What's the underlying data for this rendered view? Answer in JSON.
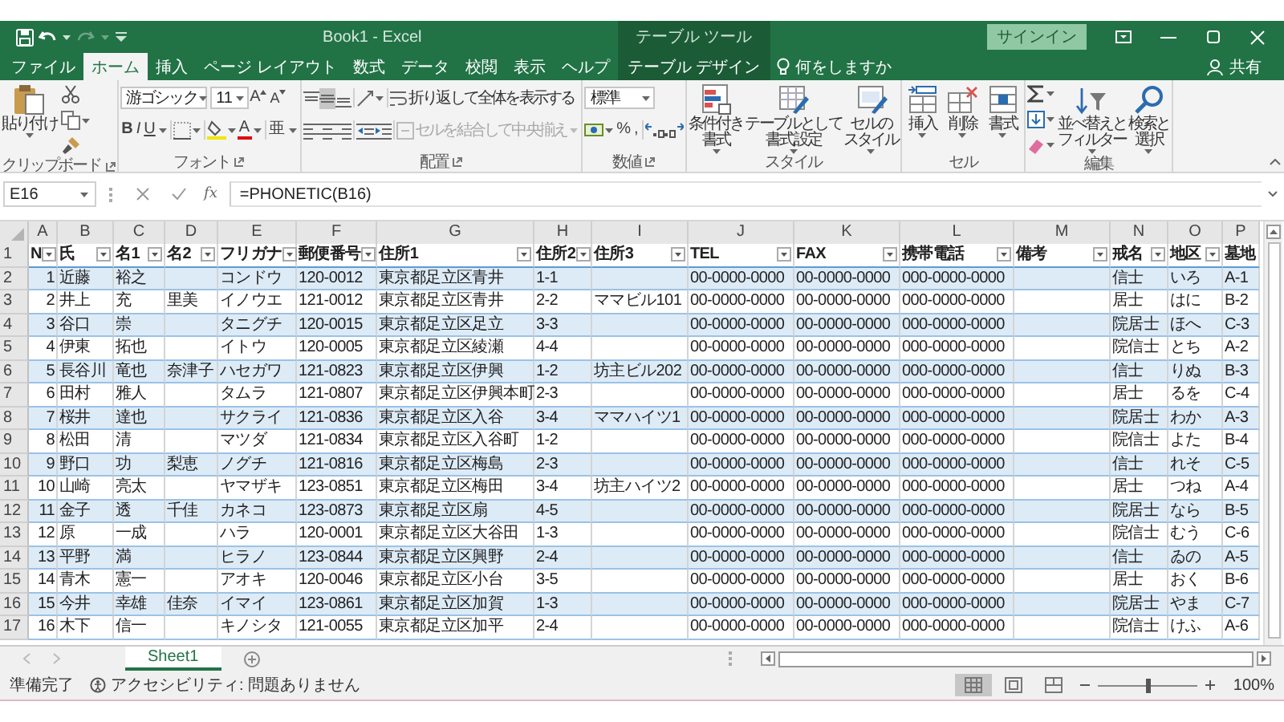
{
  "title_bar": {
    "title": "Book1 - Excel",
    "context_group": "テーブル ツール",
    "sign_in": "サインイン"
  },
  "ribbon_tabs": [
    {
      "label": "ファイル",
      "selected": false,
      "kind": "standard"
    },
    {
      "label": "ホーム",
      "selected": true,
      "kind": "standard"
    },
    {
      "label": "挿入",
      "selected": false,
      "kind": "standard"
    },
    {
      "label": "ページ レイアウト",
      "selected": false,
      "kind": "standard"
    },
    {
      "label": "数式",
      "selected": false,
      "kind": "standard"
    },
    {
      "label": "データ",
      "selected": false,
      "kind": "standard"
    },
    {
      "label": "校閲",
      "selected": false,
      "kind": "standard"
    },
    {
      "label": "表示",
      "selected": false,
      "kind": "standard"
    },
    {
      "label": "ヘルプ",
      "selected": false,
      "kind": "standard"
    },
    {
      "label": "テーブル デザイン",
      "selected": false,
      "kind": "contextual"
    }
  ],
  "tell_me": "何をしますか",
  "share": "共有",
  "ribbon": {
    "clipboard": {
      "paste": "貼り付け",
      "label": "クリップボード"
    },
    "font": {
      "font_name": "游ゴシック",
      "font_size": "11",
      "grow": "A",
      "shrink": "A",
      "bold": "B",
      "italic": "I",
      "underline": "U",
      "font_color": "A",
      "phonetic": "亜",
      "label": "フォント"
    },
    "alignment": {
      "vertical": [
        {
          "selected": false
        },
        {
          "selected": true
        },
        {
          "selected": false
        }
      ],
      "horizontal": [
        {
          "selected": false
        },
        {
          "selected": false
        },
        {
          "selected": false
        }
      ],
      "wrap_text": "折り返して全体を表示する",
      "merge": {
        "label": "セルを結合して中央揃え",
        "disabled": true
      },
      "label": "配置"
    },
    "number": {
      "format": "標準",
      "percent": "%",
      "comma": ",",
      "label": "数値"
    },
    "styles": {
      "buttons": [
        [
          "条件付き",
          "書式"
        ],
        [
          "テーブルとして",
          "書式設定"
        ],
        [
          "セルの",
          "スタイル"
        ]
      ],
      "label": "スタイル"
    },
    "cells": {
      "buttons": [
        "挿入",
        "削除",
        "書式"
      ],
      "label": "セル"
    },
    "editing": {
      "buttons": [
        [
          "並べ替えと",
          "フィルター"
        ],
        [
          "検索と",
          "選択"
        ]
      ],
      "label": "編集"
    }
  },
  "formula_bar": {
    "name_box": "E16",
    "fx": "fx",
    "formula": "=PHONETIC(B16)"
  },
  "sheet": {
    "columns": [
      "A",
      "B",
      "C",
      "D",
      "E",
      "F",
      "G",
      "H",
      "I",
      "J",
      "K",
      "L",
      "M",
      "N",
      "O",
      "P"
    ],
    "header": {
      "row": "1",
      "cells": [
        {
          "text": "N",
          "filter": true
        },
        {
          "text": "氏",
          "filter": true
        },
        {
          "text": "名1",
          "filter": true
        },
        {
          "text": "名2",
          "filter": true
        },
        {
          "text": "フリガナ",
          "filter": true
        },
        {
          "text": "郵便番号",
          "filter": true
        },
        {
          "text": "住所1",
          "filter": true
        },
        {
          "text": "住所2",
          "filter": true
        },
        {
          "text": "住所3",
          "filter": true
        },
        {
          "text": "TEL",
          "filter": true
        },
        {
          "text": "FAX",
          "filter": true
        },
        {
          "text": "携帯電話",
          "filter": true
        },
        {
          "text": "備考",
          "filter": true
        },
        {
          "text": "戒名",
          "filter": true
        },
        {
          "text": "地区",
          "filter": true
        },
        {
          "text": "墓地",
          "filter": false
        }
      ]
    },
    "rows": [
      {
        "row": "2",
        "A": "1",
        "B": "近藤",
        "C": "裕之",
        "E": "コンドウ",
        "F": "120-0012",
        "G": "東京都足立区青井",
        "H": "1-1",
        "J": "00-0000-0000",
        "K": "00-0000-0000",
        "L": "000-0000-0000",
        "N": "信士",
        "O": "いろ",
        "P": "A-1"
      },
      {
        "row": "3",
        "A": "2",
        "B": "井上",
        "C": "充",
        "D": "里美",
        "E": "イノウエ",
        "F": "121-0012",
        "G": "東京都足立区青井",
        "H": "2-2",
        "I": "ママビル101",
        "J": "00-0000-0000",
        "K": "00-0000-0000",
        "L": "000-0000-0000",
        "N": "居士",
        "O": "はに",
        "P": "B-2"
      },
      {
        "row": "4",
        "A": "3",
        "B": "谷口",
        "C": "崇",
        "E": "タニグチ",
        "F": "120-0015",
        "G": "東京都足立区足立",
        "H": "3-3",
        "J": "00-0000-0000",
        "K": "00-0000-0000",
        "L": "000-0000-0000",
        "N": "院居士",
        "O": "ほへ",
        "P": "C-3"
      },
      {
        "row": "5",
        "A": "4",
        "B": "伊東",
        "C": "拓也",
        "E": "イトウ",
        "F": "120-0005",
        "G": "東京都足立区綾瀬",
        "H": "4-4",
        "J": "00-0000-0000",
        "K": "00-0000-0000",
        "L": "000-0000-0000",
        "N": "院信士",
        "O": "とち",
        "P": "A-2"
      },
      {
        "row": "6",
        "A": "5",
        "B": "長谷川",
        "C": "竜也",
        "D": "奈津子",
        "E": "ハセガワ",
        "F": "121-0823",
        "G": "東京都足立区伊興",
        "H": "1-2",
        "I": "坊主ビル202",
        "J": "00-0000-0000",
        "K": "00-0000-0000",
        "L": "000-0000-0000",
        "N": "信士",
        "O": "りぬ",
        "P": "B-3"
      },
      {
        "row": "7",
        "A": "6",
        "B": "田村",
        "C": "雅人",
        "E": "タムラ",
        "F": "121-0807",
        "G": "東京都足立区伊興本町",
        "H": "2-3",
        "J": "00-0000-0000",
        "K": "00-0000-0000",
        "L": "000-0000-0000",
        "N": "居士",
        "O": "るを",
        "P": "C-4"
      },
      {
        "row": "8",
        "A": "7",
        "B": "桜井",
        "C": "達也",
        "E": "サクライ",
        "F": "121-0836",
        "G": "東京都足立区入谷",
        "H": "3-4",
        "I": "ママハイツ1",
        "J": "00-0000-0000",
        "K": "00-0000-0000",
        "L": "000-0000-0000",
        "N": "院居士",
        "O": "わか",
        "P": "A-3"
      },
      {
        "row": "9",
        "A": "8",
        "B": "松田",
        "C": "清",
        "E": "マツダ",
        "F": "121-0834",
        "G": "東京都足立区入谷町",
        "H": "1-2",
        "J": "00-0000-0000",
        "K": "00-0000-0000",
        "L": "000-0000-0000",
        "N": "院信士",
        "O": "よた",
        "P": "B-4"
      },
      {
        "row": "10",
        "A": "9",
        "B": "野口",
        "C": "功",
        "D": "梨恵",
        "E": "ノグチ",
        "F": "121-0816",
        "G": "東京都足立区梅島",
        "H": "2-3",
        "J": "00-0000-0000",
        "K": "00-0000-0000",
        "L": "000-0000-0000",
        "N": "信士",
        "O": "れそ",
        "P": "C-5"
      },
      {
        "row": "11",
        "A": "10",
        "B": "山崎",
        "C": "亮太",
        "E": "ヤマザキ",
        "F": "123-0851",
        "G": "東京都足立区梅田",
        "H": "3-4",
        "I": "坊主ハイツ2",
        "J": "00-0000-0000",
        "K": "00-0000-0000",
        "L": "000-0000-0000",
        "N": "居士",
        "O": "つね",
        "P": "A-4"
      },
      {
        "row": "12",
        "A": "11",
        "B": "金子",
        "C": "透",
        "D": "千佳",
        "E": "カネコ",
        "F": "123-0873",
        "G": "東京都足立区扇",
        "H": "4-5",
        "J": "00-0000-0000",
        "K": "00-0000-0000",
        "L": "000-0000-0000",
        "N": "院居士",
        "O": "なら",
        "P": "B-5"
      },
      {
        "row": "13",
        "A": "12",
        "B": "原",
        "C": "一成",
        "E": "ハラ",
        "F": "120-0001",
        "G": "東京都足立区大谷田",
        "H": "1-3",
        "J": "00-0000-0000",
        "K": "00-0000-0000",
        "L": "000-0000-0000",
        "N": "院信士",
        "O": "むう",
        "P": "C-6"
      },
      {
        "row": "14",
        "A": "13",
        "B": "平野",
        "C": "満",
        "E": "ヒラノ",
        "F": "123-0844",
        "G": "東京都足立区興野",
        "H": "2-4",
        "J": "00-0000-0000",
        "K": "00-0000-0000",
        "L": "000-0000-0000",
        "N": "信士",
        "O": "ゐの",
        "P": "A-5"
      },
      {
        "row": "15",
        "A": "14",
        "B": "青木",
        "C": "憲一",
        "E": "アオキ",
        "F": "120-0046",
        "G": "東京都足立区小台",
        "H": "3-5",
        "J": "00-0000-0000",
        "K": "00-0000-0000",
        "L": "000-0000-0000",
        "N": "居士",
        "O": "おく",
        "P": "B-6"
      },
      {
        "row": "16",
        "A": "15",
        "B": "今井",
        "C": "幸雄",
        "D": "佳奈",
        "E": "イマイ",
        "F": "123-0861",
        "G": "東京都足立区加賀",
        "H": "1-3",
        "J": "00-0000-0000",
        "K": "00-0000-0000",
        "L": "000-0000-0000",
        "N": "院居士",
        "O": "やま",
        "P": "C-7"
      },
      {
        "row": "17",
        "A": "16",
        "B": "木下",
        "C": "信一",
        "E": "キノシタ",
        "F": "121-0055",
        "G": "東京都足立区加平",
        "H": "2-4",
        "J": "00-0000-0000",
        "K": "00-0000-0000",
        "L": "000-0000-0000",
        "N": "院信士",
        "O": "けふ",
        "P": "A-6"
      }
    ]
  },
  "sheet_tabs": [
    {
      "label": "Sheet1",
      "selected": true
    }
  ],
  "status_bar": {
    "status": "準備完了",
    "accessibility": "アクセシビリティ: 問題ありません",
    "views": [
      {
        "selected": true
      },
      {
        "selected": false
      },
      {
        "selected": false
      }
    ],
    "zoom_slider": {
      "level": 0.5
    },
    "zoom": "100%"
  }
}
